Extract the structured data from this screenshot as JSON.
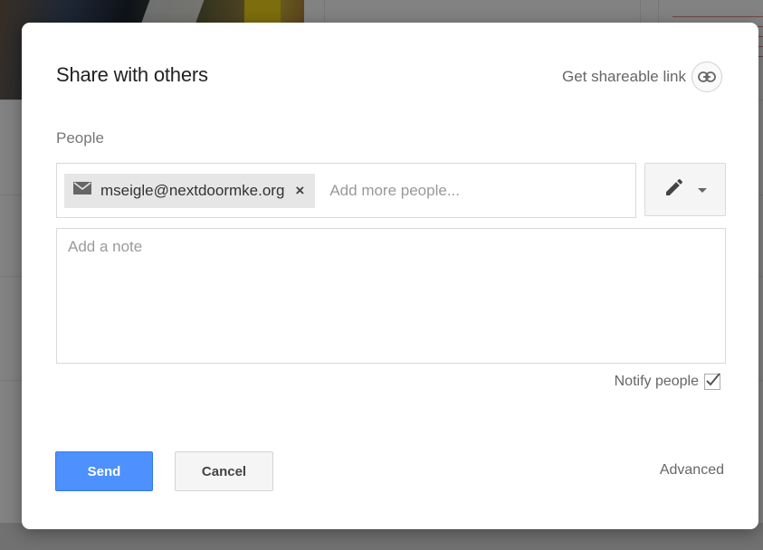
{
  "dialog": {
    "title": "Share with others",
    "shareable_link_label": "Get shareable link",
    "people_label": "People",
    "recipients": [
      {
        "email": "mseigle@nextdoormke.org"
      }
    ],
    "add_people_placeholder": "Add more people...",
    "note_placeholder": "Add a note",
    "notify_label": "Notify people",
    "notify_checked": true,
    "send_label": "Send",
    "cancel_label": "Cancel",
    "advanced_label": "Advanced"
  },
  "icons": {
    "shareable": "link-icon",
    "chip": "mail-icon",
    "chip_remove": "close-icon",
    "permission": "pencil-icon",
    "permission_menu": "chevron-down-icon",
    "notify": "checkmark-icon"
  },
  "colors": {
    "send_button": "#4d90fe",
    "chip_background": "#e6e6e6"
  }
}
